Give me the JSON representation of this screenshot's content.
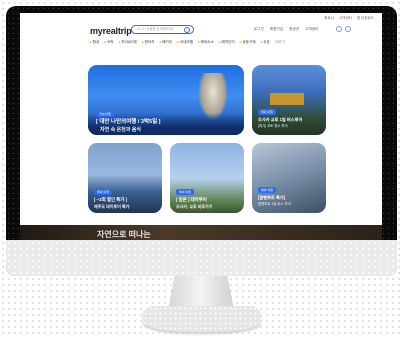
{
  "header": {
    "logo": "myrealtrip",
    "search_placeholder": "도시나 상품을 검색해보세요",
    "top_links": [
      "파트너",
      "고객센터",
      "앱 다운로드"
    ],
    "user_menu": [
      "로그인",
      "회원가입",
      "항공권",
      "고객센터"
    ],
    "categories": [
      "항공",
      "숙박",
      "투어&티켓",
      "렌터카",
      "패키지",
      "국내여행",
      "해외숙소",
      "예약관리",
      "공동구매",
      "쿠폰"
    ],
    "more": "더보기"
  },
  "cards": [
    {
      "badge": "국내 여행",
      "title": "[ 대만 나만의여행 / 3박5일 ]",
      "subtitle": "자연 속 온천과 음식"
    },
    {
      "badge": "해외 여행",
      "title": "오사카 교토 1일 버스투어",
      "subtitle": "[특가] 교토 명소 투어"
    },
    {
      "badge": "해외 여행",
      "title": "[ ~2회 할인 특가 ]",
      "subtitle": "제주도 데이투어 특가"
    },
    {
      "badge": "해외 여행",
      "title": "[ 일본 ] 테마투어",
      "subtitle": "오사카, 교토 바로가기"
    },
    {
      "badge": "해외 여행",
      "title": "[알펜루트 특가]",
      "subtitle": "알펜루트 1일 버스 투어"
    }
  ],
  "banner": {
    "text": "자연으로 떠나는"
  }
}
